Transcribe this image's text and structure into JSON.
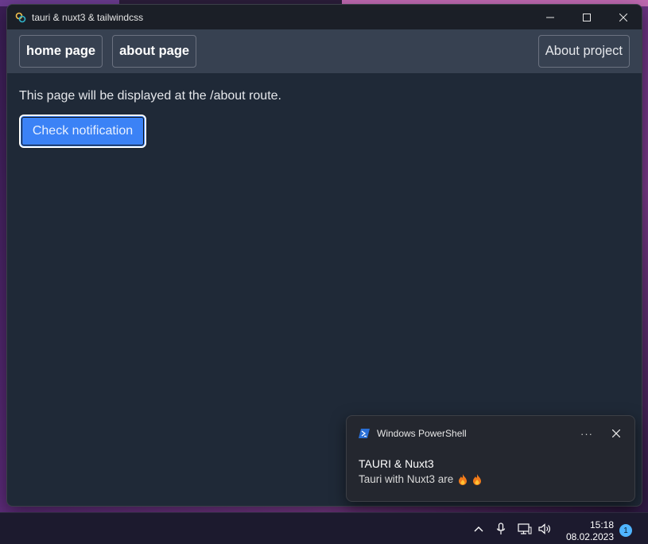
{
  "window": {
    "title": "tauri & nuxt3 & tailwindcss"
  },
  "navbar": {
    "home_label": "home page",
    "about_label": "about page",
    "project_label": "About project"
  },
  "main": {
    "description": "This page will be displayed at the /about route.",
    "notify_button_label": "Check notification"
  },
  "notification": {
    "app_name": "Windows PowerShell",
    "more_label": "···",
    "title": "TAURI & Nuxt3",
    "body": "Tauri with Nuxt3 are"
  },
  "taskbar": {
    "time": "15:18",
    "date": "08.02.2023",
    "notification_count": "1"
  }
}
